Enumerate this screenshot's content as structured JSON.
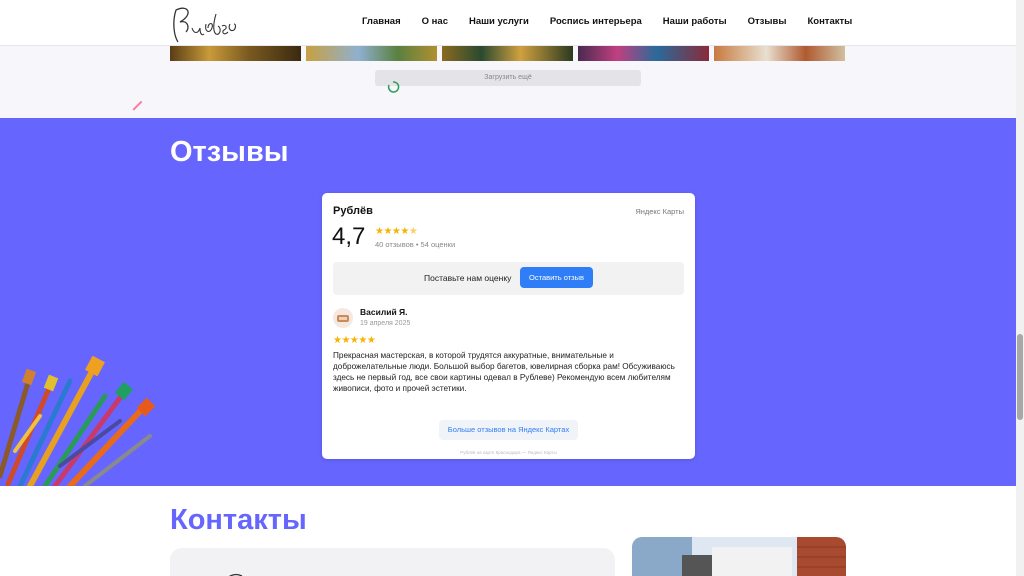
{
  "header": {
    "logo_text": "Рублёв",
    "nav": [
      {
        "label": "Главная"
      },
      {
        "label": "О нас"
      },
      {
        "label": "Наши услуги"
      },
      {
        "label": "Роспись интерьера"
      },
      {
        "label": "Наши работы"
      },
      {
        "label": "Отзывы"
      },
      {
        "label": "Контакты"
      }
    ]
  },
  "gallery": {
    "load_more_label": "Загрузить ещё"
  },
  "reviews": {
    "title": "Отзывы",
    "widget": {
      "business_name": "Рублёв",
      "source": "Яндекс Карты",
      "rating": "4,7",
      "rating_stars": 4.7,
      "counts": "40 отзывов • 54 оценки",
      "rate_prompt": "Поставьте нам оценку",
      "rate_button": "Оставить отзыв",
      "review": {
        "author": "Василий Я.",
        "date": "19 апреля 2025",
        "stars": 5,
        "text": "Прекрасная мастерская, в которой трудятся аккуратные, внимательные и доброжелательные люди. Большой выбор багетов, ювелирная сборка рам! Обсуживаюсь здесь не первый год, все свои картины одевал в Рублеве) Рекомендую всем любителям живописи, фото и прочей эстетики."
      },
      "more_button": "Больше отзывов на Яндекс Картах",
      "footer_note": "Рублёв на карте Краснодара — Яндекс Карты"
    }
  },
  "contacts": {
    "title": "Контакты"
  },
  "colors": {
    "accent": "#6666ff",
    "button_blue": "#2f7ef7",
    "star": "#f5b400"
  }
}
